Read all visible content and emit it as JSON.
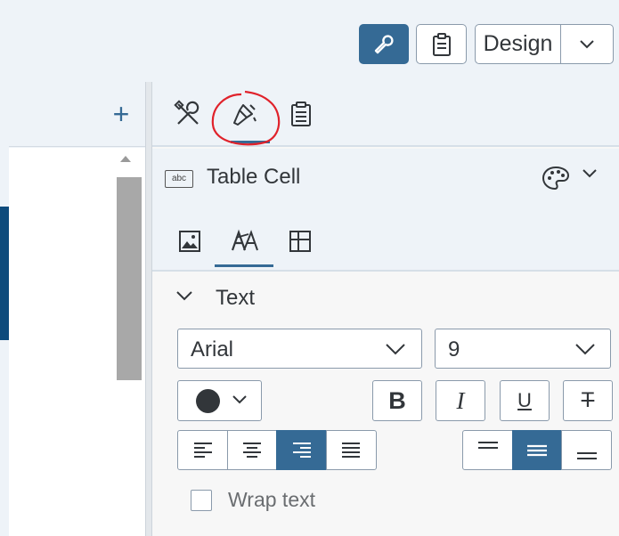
{
  "toolbar": {
    "tools_icon": "wrench-icon",
    "clipboard_icon": "clipboard-icon",
    "mode_label": "Design",
    "mode_dropdown_icon": "chevron-down-icon"
  },
  "left_pane": {
    "add_icon_text": "+"
  },
  "panel": {
    "tabs": [
      {
        "name": "builder",
        "icon": "tools-icon"
      },
      {
        "name": "styling",
        "icon": "paintbrush-icon",
        "selected": true
      },
      {
        "name": "notes",
        "icon": "clipboard-icon"
      }
    ],
    "selection_title": "Table Cell",
    "selection_icon_text": "abc",
    "sub_tabs": [
      {
        "name": "image",
        "icon": "image-icon"
      },
      {
        "name": "text",
        "icon": "text-style-icon",
        "selected": true
      },
      {
        "name": "table",
        "icon": "table-icon"
      }
    ],
    "section": {
      "title": "Text",
      "font_family": "Arial",
      "font_size": "9",
      "text_color": "#32363a",
      "bold_label": "B",
      "italic_label": "I",
      "underline_label": "U",
      "strike_label": "T",
      "horizontal_align": [
        "left",
        "center",
        "right",
        "justify"
      ],
      "horizontal_align_selected": "right",
      "vertical_align": [
        "top",
        "middle",
        "bottom"
      ],
      "vertical_align_selected": "middle",
      "wrap_label": "Wrap text",
      "wrap_checked": false
    }
  },
  "colors": {
    "accent": "#356a95",
    "annotation": "#e0222b"
  }
}
